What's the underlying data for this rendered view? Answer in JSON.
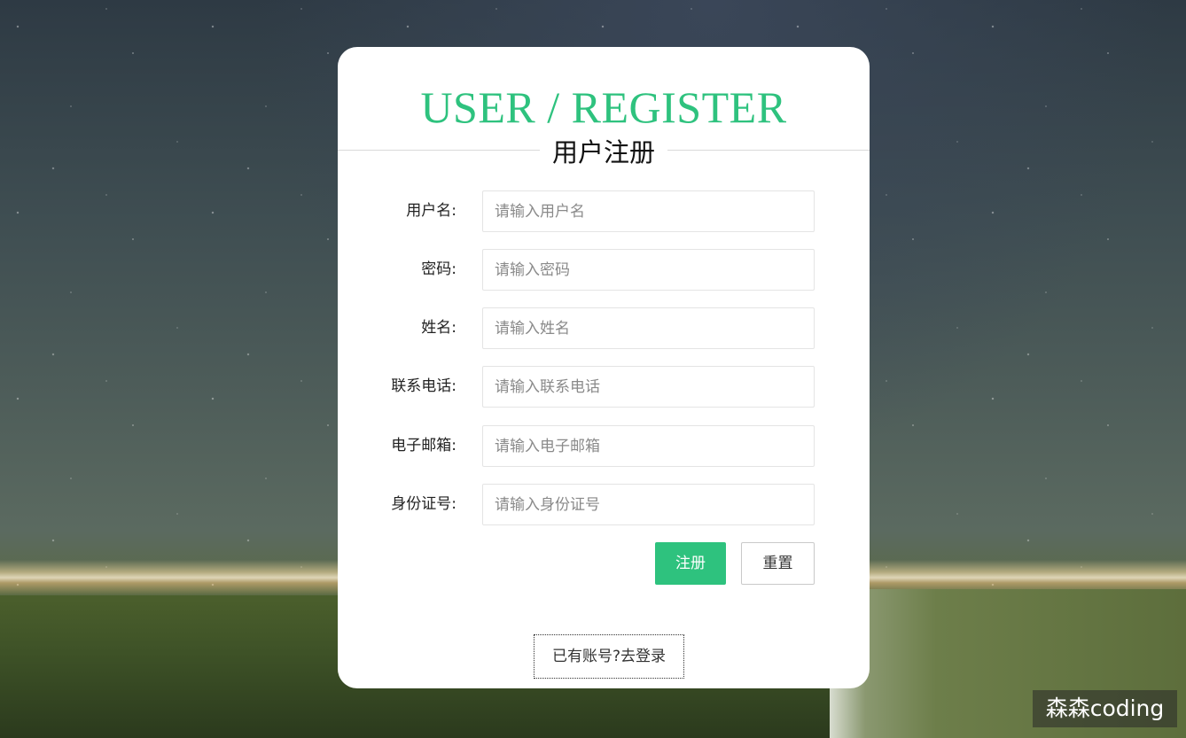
{
  "card": {
    "title_en": "USER / REGISTER",
    "title_cn": "用户注册"
  },
  "form": {
    "fields": [
      {
        "label": "用户名:",
        "placeholder": "请输入用户名",
        "value": ""
      },
      {
        "label": "密码:",
        "placeholder": "请输入密码",
        "value": ""
      },
      {
        "label": "姓名:",
        "placeholder": "请输入姓名",
        "value": ""
      },
      {
        "label": "联系电话:",
        "placeholder": "请输入联系电话",
        "value": ""
      },
      {
        "label": "电子邮箱:",
        "placeholder": "请输入电子邮箱",
        "value": ""
      },
      {
        "label": "身份证号:",
        "placeholder": "请输入身份证号",
        "value": ""
      }
    ],
    "submit_label": "注册",
    "reset_label": "重置"
  },
  "login_link": "已有账号?去登录",
  "watermark": "森森coding",
  "colors": {
    "accent": "#2ec27e",
    "card_bg": "#ffffff",
    "input_border": "#e4e4e4"
  }
}
